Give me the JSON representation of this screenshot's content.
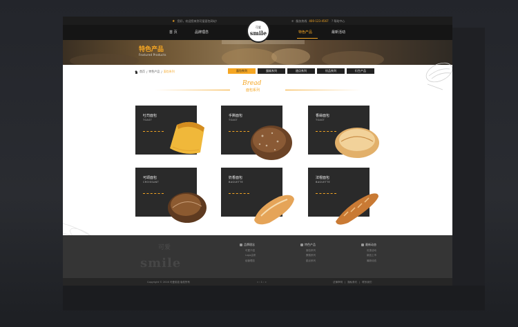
{
  "topbar": {
    "welcome": "您好，欢迎您来到可爱面包网站！",
    "hotline_label": "服务热线",
    "hotline_number": "400-123-4567",
    "help": "帮助中心"
  },
  "nav": {
    "items": [
      "首 页",
      "品牌理念",
      "特色产品",
      "最新活动"
    ],
    "active": "特色产品"
  },
  "logo": {
    "cn": "可爱",
    "en": "smile"
  },
  "banner": {
    "title": "特色产品",
    "subtitle": "Featured Products"
  },
  "breadcrumb": {
    "home": "首页",
    "sep": "/",
    "level2": "特色产品",
    "current": "面包系列"
  },
  "categories": [
    "面包系列",
    "蛋糕系列",
    "甜点系列",
    "饮品系列",
    "衍生产品"
  ],
  "section": {
    "script": "Bread",
    "title": "面包系列"
  },
  "products": [
    {
      "name": "吐司面包",
      "en": "TOAST"
    },
    {
      "name": "手撕面包",
      "en": "TOAST"
    },
    {
      "name": "香蒜面包",
      "en": "TOAST"
    },
    {
      "name": "可颂面包",
      "en": "CROISSANT"
    },
    {
      "name": "奶香面包",
      "en": "BAGUETTE"
    },
    {
      "name": "法棍面包",
      "en": "BAGUETTE"
    }
  ],
  "footer": {
    "logo_cn": "可爱",
    "logo_en": "smile",
    "columns": [
      {
        "title": "品牌理念",
        "items": [
          "可爱介绍",
          "Logo由来",
          "经营理念"
        ]
      },
      {
        "title": "特色产品",
        "items": [
          "面包系列",
          "蛋糕系列",
          "甜点系列"
        ]
      },
      {
        "title": "最新动态",
        "items": [
          "优惠活动",
          "新品上市",
          "最新动态"
        ]
      }
    ]
  },
  "bottombar": {
    "copyright": "Copyright © 2016 可爱烘焙 版权所有",
    "pager": "« ‹ 1 › »",
    "links": [
      "法律声明",
      "隐私条约",
      "联系我们"
    ]
  },
  "colors": {
    "accent": "#f5a623",
    "dark": "#2a2a2a",
    "background": "#24262c"
  }
}
